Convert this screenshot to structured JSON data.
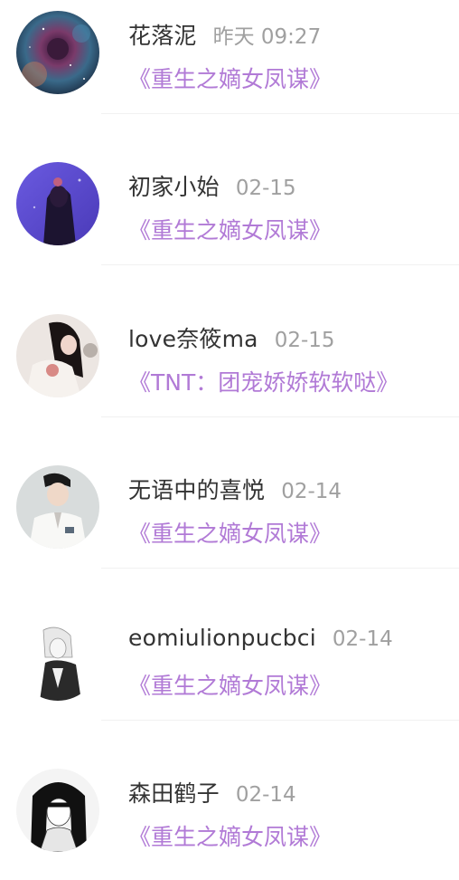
{
  "items": [
    {
      "name": "花落泥",
      "time": "昨天 09:27",
      "book": "《重生之嫡女凤谋》",
      "avatar": "nebula-avatar"
    },
    {
      "name": "初家小始",
      "time": "02-15",
      "book": "《重生之嫡女凤谋》",
      "avatar": "purple-girl-avatar"
    },
    {
      "name": "love奈筱ma",
      "time": "02-15",
      "book": "《TNT：团宠娇娇软软哒》",
      "avatar": "girl-hoodie-avatar"
    },
    {
      "name": "无语中的喜悦",
      "time": "02-14",
      "book": "《重生之嫡女凤谋》",
      "avatar": "doctor-avatar"
    },
    {
      "name": "eomiulionpucbci",
      "time": "02-14",
      "book": "《重生之嫡女凤谋》",
      "avatar": "anime-bw-avatar"
    },
    {
      "name": "森田鹤子",
      "time": "02-14",
      "book": "《重生之嫡女凤谋》",
      "avatar": "manga-girl-avatar"
    }
  ],
  "colors": {
    "name": "#333333",
    "time": "#a0a0a0",
    "book_link": "#b17ad6",
    "divider": "#f1f1f1"
  }
}
